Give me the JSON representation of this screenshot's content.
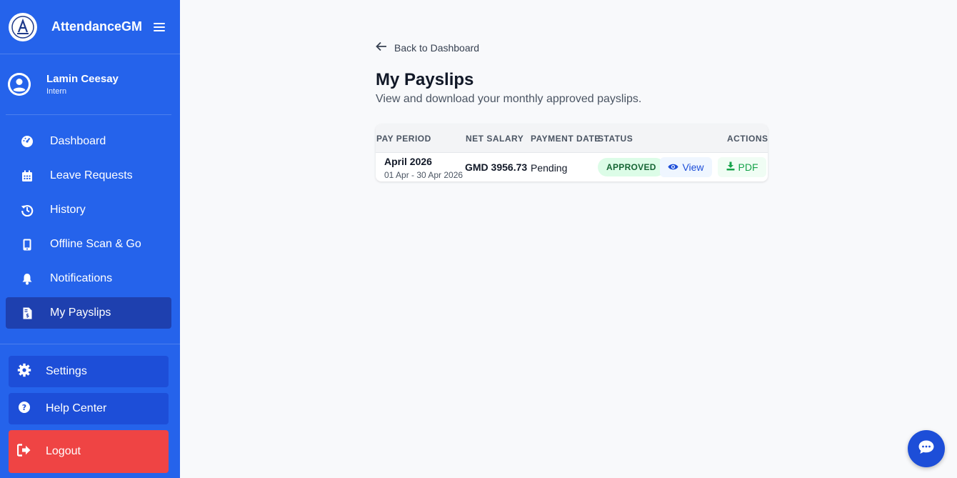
{
  "app": {
    "name": "AttendanceGM"
  },
  "user": {
    "name": "Lamin Ceesay",
    "role": "Intern"
  },
  "sidebar": {
    "items": [
      {
        "label": "Dashboard",
        "icon": "gauge-icon"
      },
      {
        "label": "Leave Requests",
        "icon": "calendar-icon"
      },
      {
        "label": "History",
        "icon": "history-icon"
      },
      {
        "label": "Offline Scan & Go",
        "icon": "mobile-icon"
      },
      {
        "label": "Notifications",
        "icon": "bell-icon"
      },
      {
        "label": "My Payslips",
        "icon": "invoice-icon",
        "active": true
      }
    ],
    "bottom": [
      {
        "label": "Settings",
        "icon": "gear-icon"
      },
      {
        "label": "Help Center",
        "icon": "question-icon"
      },
      {
        "label": "Logout",
        "icon": "logout-icon"
      }
    ]
  },
  "main": {
    "back_label": "Back to Dashboard",
    "title": "My Payslips",
    "subtitle": "View and download your monthly approved payslips.",
    "table": {
      "headers": [
        "PAY PERIOD",
        "NET SALARY",
        "PAYMENT DATE",
        "STATUS",
        "ACTIONS"
      ],
      "rows": [
        {
          "period": "April 2026",
          "range": "01 Apr - 30 Apr 2026",
          "net_salary": "GMD 3956.73",
          "payment_date": "Pending",
          "status": "APPROVED",
          "view_label": "View",
          "pdf_label": "PDF"
        }
      ]
    }
  },
  "colors": {
    "sidebar": "#2563eb",
    "active_item": "#1e40af",
    "logout": "#ef4444",
    "approved_bg": "#dcfce7",
    "approved_text": "#166534"
  }
}
